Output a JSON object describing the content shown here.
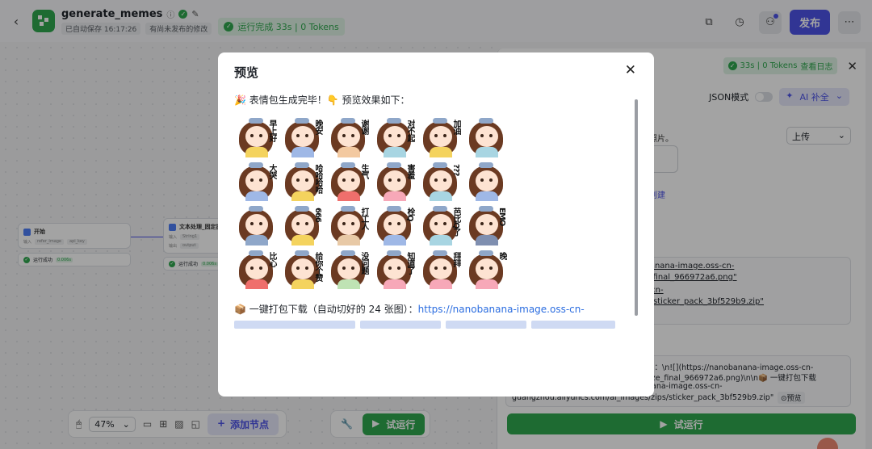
{
  "topbar": {
    "workflow_name": "generate_memes",
    "autosave": "已自动保存 16:17:26",
    "unpublished": "有尚未发布的修改",
    "run_status": "运行完成 33s | 0 Tokens",
    "publish_label": "发布"
  },
  "canvas": {
    "start_node": {
      "title": "开始",
      "row_label_1": "输入",
      "chip_1": "refer_image",
      "chip_2": "api_key",
      "status": "运行成功",
      "time": "0.006s"
    },
    "text_node": {
      "title": "文本处理_固定提示",
      "row_label_1": "输入",
      "chip_1": "String1",
      "row_label_2": "输出",
      "chip_2": "output",
      "status": "运行成功",
      "time": "0.006s"
    },
    "zoom": "47%",
    "add_node_label": "添加节点",
    "trial_run_label": "试运行"
  },
  "panel": {
    "status": "33s | 0 Tokens",
    "view_log": "查看日志",
    "json_mode": "JSON模式",
    "ai_complete": "AI 补全",
    "upload": "上传",
    "frag_photo": "照片。",
    "frag_create": "创建",
    "link_1a": "agnanana-image.oss-cn-",
    "link_1b": "oze_final_966972a6.png\"",
    "link_2a": "oss-cn-",
    "link_2b": "zips/sticker_pack_3bf529b9.zip\"",
    "out_1": "下：\\n![](https://nanobanana-image.oss-cn-",
    "out_2": "oze_final_966972a6.png)\\n\\n📦 一键打包下载",
    "out_3": "nana-image.oss-cn-",
    "out_4": "guangzhou.aliyuncs.com/ai_images/zips/sticker_pack_3bf529b9.zip\"",
    "preview_chip": "⊙预览",
    "run_label": "试运行"
  },
  "modal": {
    "title": "预览",
    "intro": "🎉 表情包生成完毕！👇 预览效果如下：",
    "download_prefix": "📦 一键打包下载（自动切好的 24 张图）：",
    "download_link": "https://nanobanana-image.oss-cn-",
    "stickers": [
      {
        "text": "早上好",
        "shirt": "#f4d35e"
      },
      {
        "text": "晚安",
        "shirt": "#9fb8e6"
      },
      {
        "text": "谢谢",
        "shirt": "#f3c9a0"
      },
      {
        "text": "对不起",
        "shirt": "#a8d5e2"
      },
      {
        "text": "加油",
        "shirt": "#f4d35e"
      },
      {
        "text": "",
        "shirt": "#a8d5e2"
      },
      {
        "text": "大哭",
        "shirt": "#9fb8e6"
      },
      {
        "text": "哈哈哈哈",
        "shirt": "#f4d35e"
      },
      {
        "text": "生气",
        "shirt": "#ef6f6c"
      },
      {
        "text": "害羞",
        "shirt": "#f7a8b8"
      },
      {
        "text": "???",
        "shirt": "#a8d5e2"
      },
      {
        "text": "",
        "shirt": "#9fb8e6"
      },
      {
        "text": "",
        "shirt": "#8fa7c9"
      },
      {
        "text": "666",
        "shirt": "#f4d35e"
      },
      {
        "text": "打工人",
        "shirt": "#e8c9a6"
      },
      {
        "text": "栓Q",
        "shirt": "#9fb8e6"
      },
      {
        "text": "芭比Q了",
        "shirt": "#a8d5e2"
      },
      {
        "text": "EMO",
        "shirt": "#7f8fb0"
      },
      {
        "text": "比心",
        "shirt": "#ef6f6c"
      },
      {
        "text": "给你个赞",
        "shirt": "#f4d35e"
      },
      {
        "text": "没问题",
        "shirt": "#bfe3b4"
      },
      {
        "text": "知道了",
        "shirt": "#f7a8b8"
      },
      {
        "text": "拜拜",
        "shirt": "#f7a8b8"
      },
      {
        "text": "晚",
        "shirt": "#f7a8b8"
      }
    ]
  },
  "colors": {
    "accent": "#4d53e8",
    "success": "#2fa84f",
    "link": "#2b6de0"
  }
}
